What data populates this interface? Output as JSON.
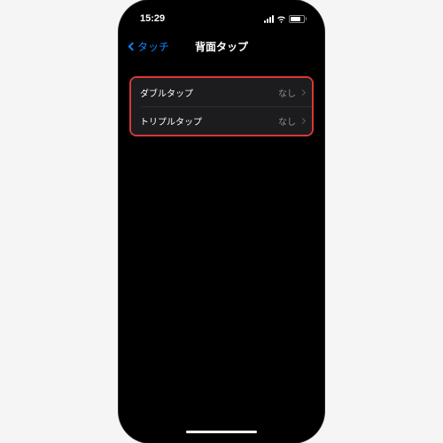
{
  "status": {
    "time": "15:29",
    "battery": "72"
  },
  "nav": {
    "back_label": "タッチ",
    "title": "背面タップ"
  },
  "rows": [
    {
      "label": "ダブルタップ",
      "value": "なし"
    },
    {
      "label": "トリプルタップ",
      "value": "なし"
    }
  ],
  "colors": {
    "accent": "#0a84ff",
    "highlight_border": "#d93838",
    "row_bg": "#1c1c1e"
  }
}
